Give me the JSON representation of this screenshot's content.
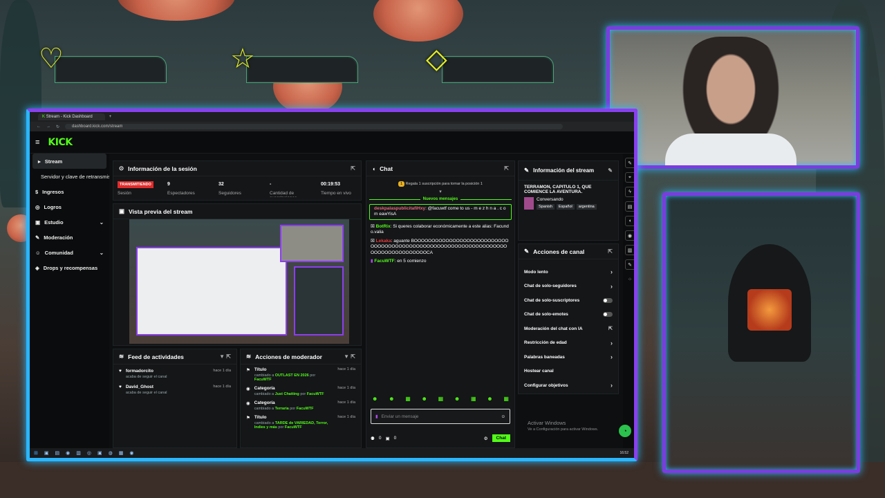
{
  "goals": [
    {
      "icon": "heart-icon",
      "glyph": "♡"
    },
    {
      "icon": "star-icon",
      "glyph": "☆"
    },
    {
      "icon": "diamond-icon",
      "glyph": "◇"
    }
  ],
  "browser": {
    "tab_title": "Stream - Kick Dashboard",
    "url": "dashboard.kick.com/stream"
  },
  "brand": {
    "logo": "KICK"
  },
  "sidebar": {
    "items": [
      {
        "label": "Stream",
        "icon": "▸"
      },
      {
        "label": "Servidor y clave de retransmisión",
        "icon": ""
      },
      {
        "label": "Ingresos",
        "icon": "$"
      },
      {
        "label": "Logros",
        "icon": "◎"
      },
      {
        "label": "Estudio",
        "icon": "▣",
        "chevron": "⌄"
      },
      {
        "label": "Moderación",
        "icon": "✎"
      },
      {
        "label": "Comunidad",
        "icon": "☺",
        "chevron": "⌄"
      },
      {
        "label": "Drops y recompensas",
        "icon": "◈"
      }
    ]
  },
  "session": {
    "title": "Información de la sesión",
    "live_badge": "TRANSMITIENDO",
    "live_label": "Sesión",
    "stats": [
      {
        "value": "9",
        "label": "Espectadores"
      },
      {
        "value": "32",
        "label": "Seguidores"
      },
      {
        "value": "-",
        "label": "Cantidad de suscripciones"
      },
      {
        "value": "00:19:53",
        "label": "Tiempo en vivo"
      }
    ]
  },
  "preview": {
    "title": "Vista previa del stream"
  },
  "activity": {
    "title": "Feed de actividades",
    "items": [
      {
        "user": "formadorcito",
        "text": "acaba de seguir el canal",
        "time": "hace 1 día"
      },
      {
        "user": "David_Ghost",
        "text": "acaba de seguir el canal",
        "time": "hace 1 día"
      }
    ]
  },
  "modactions": {
    "title": "Acciones de moderador",
    "items": [
      {
        "title": "Título",
        "pre": "cambiado a",
        "value": "OUTLAST EN 2026",
        "by": "por",
        "user": "FacuWTF",
        "time": "hace 1 día"
      },
      {
        "title": "Categoría",
        "pre": "cambiado a",
        "value": "Just Chatting",
        "by": "por",
        "user": "FacuWTF",
        "time": "hace 1 día"
      },
      {
        "title": "Categoría",
        "pre": "cambiado a",
        "value": "Terraria",
        "by": "por",
        "user": "FacuWTF",
        "time": "hace 1 día"
      },
      {
        "title": "Título",
        "pre": "cambiado a",
        "value": "TARDE de VARIEDAD, Terror, Indies y más",
        "by": "por",
        "user": "FacuWTF",
        "time": "hace 1 día"
      }
    ]
  },
  "chat": {
    "title": "Chat",
    "gift_text": "Regala 1 suscripción para tomar la posición 1",
    "new_messages": "Nuevos mensajes",
    "messages": [
      {
        "user": "deskpalaspublicitafiHxy",
        "color": "#e86a7a",
        "text": ": @facuwtf come to us - m e z h n a . c o m eawYisA",
        "highlight": true
      },
      {
        "user": "BotRix",
        "color": "#53fc18",
        "text": ": Si queres colaborar económicamente a este alias: Facundo.valia",
        "highlight": false
      },
      {
        "user": "Lekaka",
        "color": "#e83a3a",
        "text": ": aguante BOOOOOOOOOOOOOOOOOOOOOOOOOOOOOOOOOOOOOOOOOOOOOOOOOOOOOOOOOOOOOOOOOOOOOOOOOOOOOOOOOOCA",
        "highlight": false
      },
      {
        "user": "FacuWTF",
        "color": "#53fc18",
        "text": ": en 5 comienzo",
        "highlight": false
      }
    ],
    "input_placeholder": "Enviar un mensaje",
    "viewers_count": "0",
    "points": "0",
    "send_label": "Chat"
  },
  "stream_info": {
    "title": "Información del stream",
    "stream_title": "TERRAMON, CAPITULO 1, QUE COMIENCE LA AVENTURA.",
    "category": "Conversando",
    "tags": [
      "Spanish",
      "Español",
      "argentina"
    ]
  },
  "channel_actions": {
    "title": "Acciones de canal",
    "rows": [
      {
        "label": "Modo lento",
        "kind": "arrow"
      },
      {
        "label": "Chat de solo-seguidores",
        "kind": "arrow"
      },
      {
        "label": "Chat de solo-suscriptores",
        "kind": "toggle"
      },
      {
        "label": "Chat de solo-emotes",
        "kind": "toggle"
      },
      {
        "label": "Moderación del chat con IA",
        "kind": "ext"
      },
      {
        "label": "Restricción de edad",
        "kind": "arrow"
      },
      {
        "label": "Palabras baneadas",
        "kind": "arrow"
      },
      {
        "label": "Hostear canal",
        "kind": "none"
      },
      {
        "label": "Configurar objetivos",
        "kind": "arrow"
      }
    ]
  },
  "watermark": {
    "title": "Activar Windows",
    "sub": "Ve a Configuración para activar Windows."
  },
  "clock": {
    "time": "16:52"
  }
}
